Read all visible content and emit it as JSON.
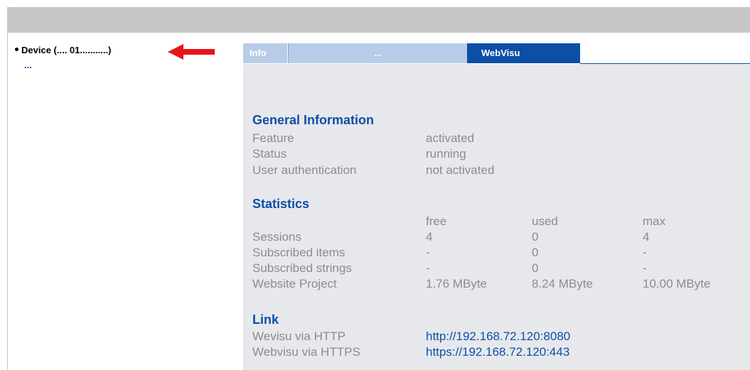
{
  "tree": {
    "root_label": "Device (.... 01...........)",
    "child_label": "..."
  },
  "tabs": [
    {
      "label": "Info"
    },
    {
      "label": "..."
    },
    {
      "label": "WebVisu"
    }
  ],
  "general": {
    "title": "General Information",
    "rows": [
      {
        "label": "Feature",
        "value": "activated"
      },
      {
        "label": "Status",
        "value": "running"
      },
      {
        "label": "User authentication",
        "value": "not activated"
      }
    ]
  },
  "statistics": {
    "title": "Statistics",
    "headers": [
      "free",
      "used",
      "max"
    ],
    "rows": [
      {
        "label": "Sessions",
        "free": "4",
        "used": "0",
        "max": "4"
      },
      {
        "label": "Subscribed items",
        "free": "-",
        "used": "0",
        "max": "-"
      },
      {
        "label": "Subscribed strings",
        "free": "-",
        "used": "0",
        "max": "-"
      },
      {
        "label": "Website Project",
        "free": "1.76 MByte",
        "used": "8.24 MByte",
        "max": "10.00 MByte"
      }
    ]
  },
  "link": {
    "title": "Link",
    "rows": [
      {
        "label": "Wevisu via HTTP",
        "url": "http://192.168.72.120:8080"
      },
      {
        "label": "Webvisu via HTTPS",
        "url": "https://192.168.72.120:443"
      }
    ]
  },
  "colors": {
    "accent": "#0d4fa6",
    "tab_inactive": "#b8cbe8",
    "panel_bg": "#e6e8ec",
    "arrow": "#e8141b"
  }
}
